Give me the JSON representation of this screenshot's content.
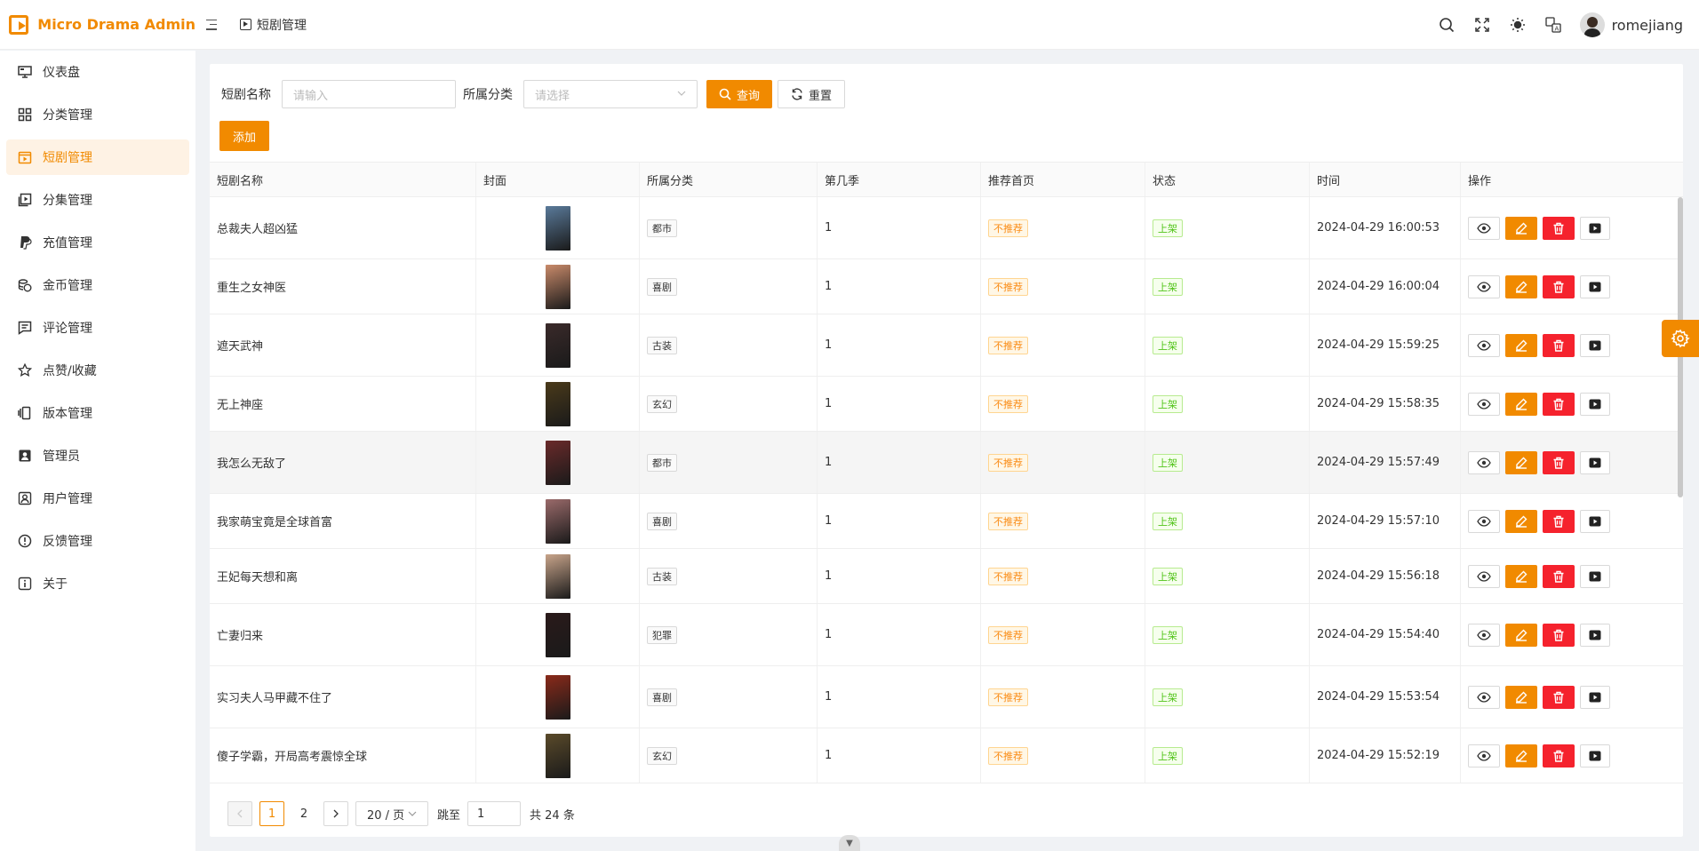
{
  "app": {
    "title": "Micro Drama Admin"
  },
  "breadcrumb": {
    "current": "短剧管理"
  },
  "header": {
    "username": "romejiang"
  },
  "sidebar": {
    "items": [
      {
        "label": "仪表盘",
        "icon": "dashboard-icon"
      },
      {
        "label": "分类管理",
        "icon": "grid-icon"
      },
      {
        "label": "短剧管理",
        "icon": "video-box-icon",
        "active": true
      },
      {
        "label": "分集管理",
        "icon": "episodes-icon"
      },
      {
        "label": "充值管理",
        "icon": "paypal-icon"
      },
      {
        "label": "金币管理",
        "icon": "coins-icon"
      },
      {
        "label": "评论管理",
        "icon": "comment-icon"
      },
      {
        "label": "点赞/收藏",
        "icon": "star-icon"
      },
      {
        "label": "版本管理",
        "icon": "versions-icon"
      },
      {
        "label": "管理员",
        "icon": "admin-icon"
      },
      {
        "label": "用户管理",
        "icon": "user-icon"
      },
      {
        "label": "反馈管理",
        "icon": "feedback-icon"
      },
      {
        "label": "关于",
        "icon": "info-icon"
      }
    ]
  },
  "filter": {
    "name_label": "短剧名称",
    "name_placeholder": "请输入",
    "category_label": "所属分类",
    "category_placeholder": "请选择",
    "search_label": "查询",
    "reset_label": "重置"
  },
  "add_label": "添加",
  "table": {
    "columns": [
      "短剧名称",
      "封面",
      "所属分类",
      "第几季",
      "推荐首页",
      "状态",
      "时间",
      "操作"
    ],
    "rows": [
      {
        "name": "总裁夫人超凶猛",
        "category": "都市",
        "season": "1",
        "recommend": "不推荐",
        "status": "上架",
        "time": "2024-04-29 16:00:53",
        "cover_color": "#5a7a9a"
      },
      {
        "name": "重生之女神医",
        "category": "喜剧",
        "season": "1",
        "recommend": "不推荐",
        "status": "上架",
        "time": "2024-04-29 16:00:04",
        "cover_color": "#c98a6a"
      },
      {
        "name": "遮天武神",
        "category": "古装",
        "season": "1",
        "recommend": "不推荐",
        "status": "上架",
        "time": "2024-04-29 15:59:25",
        "cover_color": "#3a2a2a"
      },
      {
        "name": "无上神座",
        "category": "玄幻",
        "season": "1",
        "recommend": "不推荐",
        "status": "上架",
        "time": "2024-04-29 15:58:35",
        "cover_color": "#4a3a1a"
      },
      {
        "name": "我怎么无敌了",
        "category": "都市",
        "season": "1",
        "recommend": "不推荐",
        "status": "上架",
        "time": "2024-04-29 15:57:49",
        "cover_color": "#6a2a2a"
      },
      {
        "name": "我家萌宝竟是全球首富",
        "category": "喜剧",
        "season": "1",
        "recommend": "不推荐",
        "status": "上架",
        "time": "2024-04-29 15:57:10",
        "cover_color": "#9a6a6a"
      },
      {
        "name": "王妃每天想和离",
        "category": "古装",
        "season": "1",
        "recommend": "不推荐",
        "status": "上架",
        "time": "2024-04-29 15:56:18",
        "cover_color": "#c8a48a"
      },
      {
        "name": "亡妻归来",
        "category": "犯罪",
        "season": "1",
        "recommend": "不推荐",
        "status": "上架",
        "time": "2024-04-29 15:54:40",
        "cover_color": "#2a1a1a"
      },
      {
        "name": "实习夫人马甲藏不住了",
        "category": "喜剧",
        "season": "1",
        "recommend": "不推荐",
        "status": "上架",
        "time": "2024-04-29 15:53:54",
        "cover_color": "#8a2a1a"
      },
      {
        "name": "傻子学霸，开局高考震惊全球",
        "category": "玄幻",
        "season": "1",
        "recommend": "不推荐",
        "status": "上架",
        "time": "2024-04-29 15:52:19",
        "cover_color": "#5a4a2a"
      }
    ]
  },
  "pagination": {
    "page1": "1",
    "page2": "2",
    "page_size": "20 / 页",
    "jump_label": "跳至",
    "jump_value": "1",
    "total": "共 24 条"
  },
  "colors": {
    "accent": "#f18a00",
    "danger": "#f5222d",
    "success": "#52c41a"
  }
}
